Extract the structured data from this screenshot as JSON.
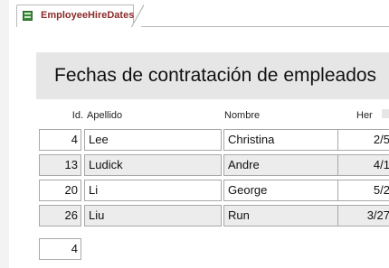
{
  "tab": {
    "label": "EmployeeHireDates"
  },
  "report": {
    "title": "Fechas de contratación de empleados"
  },
  "columns": {
    "id": "Id.",
    "last": "Apellido",
    "first": "Nombre",
    "hire": "Her"
  },
  "rows": [
    {
      "id": "4",
      "last": "Lee",
      "first": "Christina",
      "hire": "2/5"
    },
    {
      "id": "13",
      "last": "Ludick",
      "first": "Andre",
      "hire": "4/1"
    },
    {
      "id": "20",
      "last": "Li",
      "first": "George",
      "hire": "5/2"
    },
    {
      "id": "26",
      "last": "Liu",
      "first": "Run",
      "hire": "3/27"
    }
  ],
  "footer": {
    "count": "4"
  }
}
